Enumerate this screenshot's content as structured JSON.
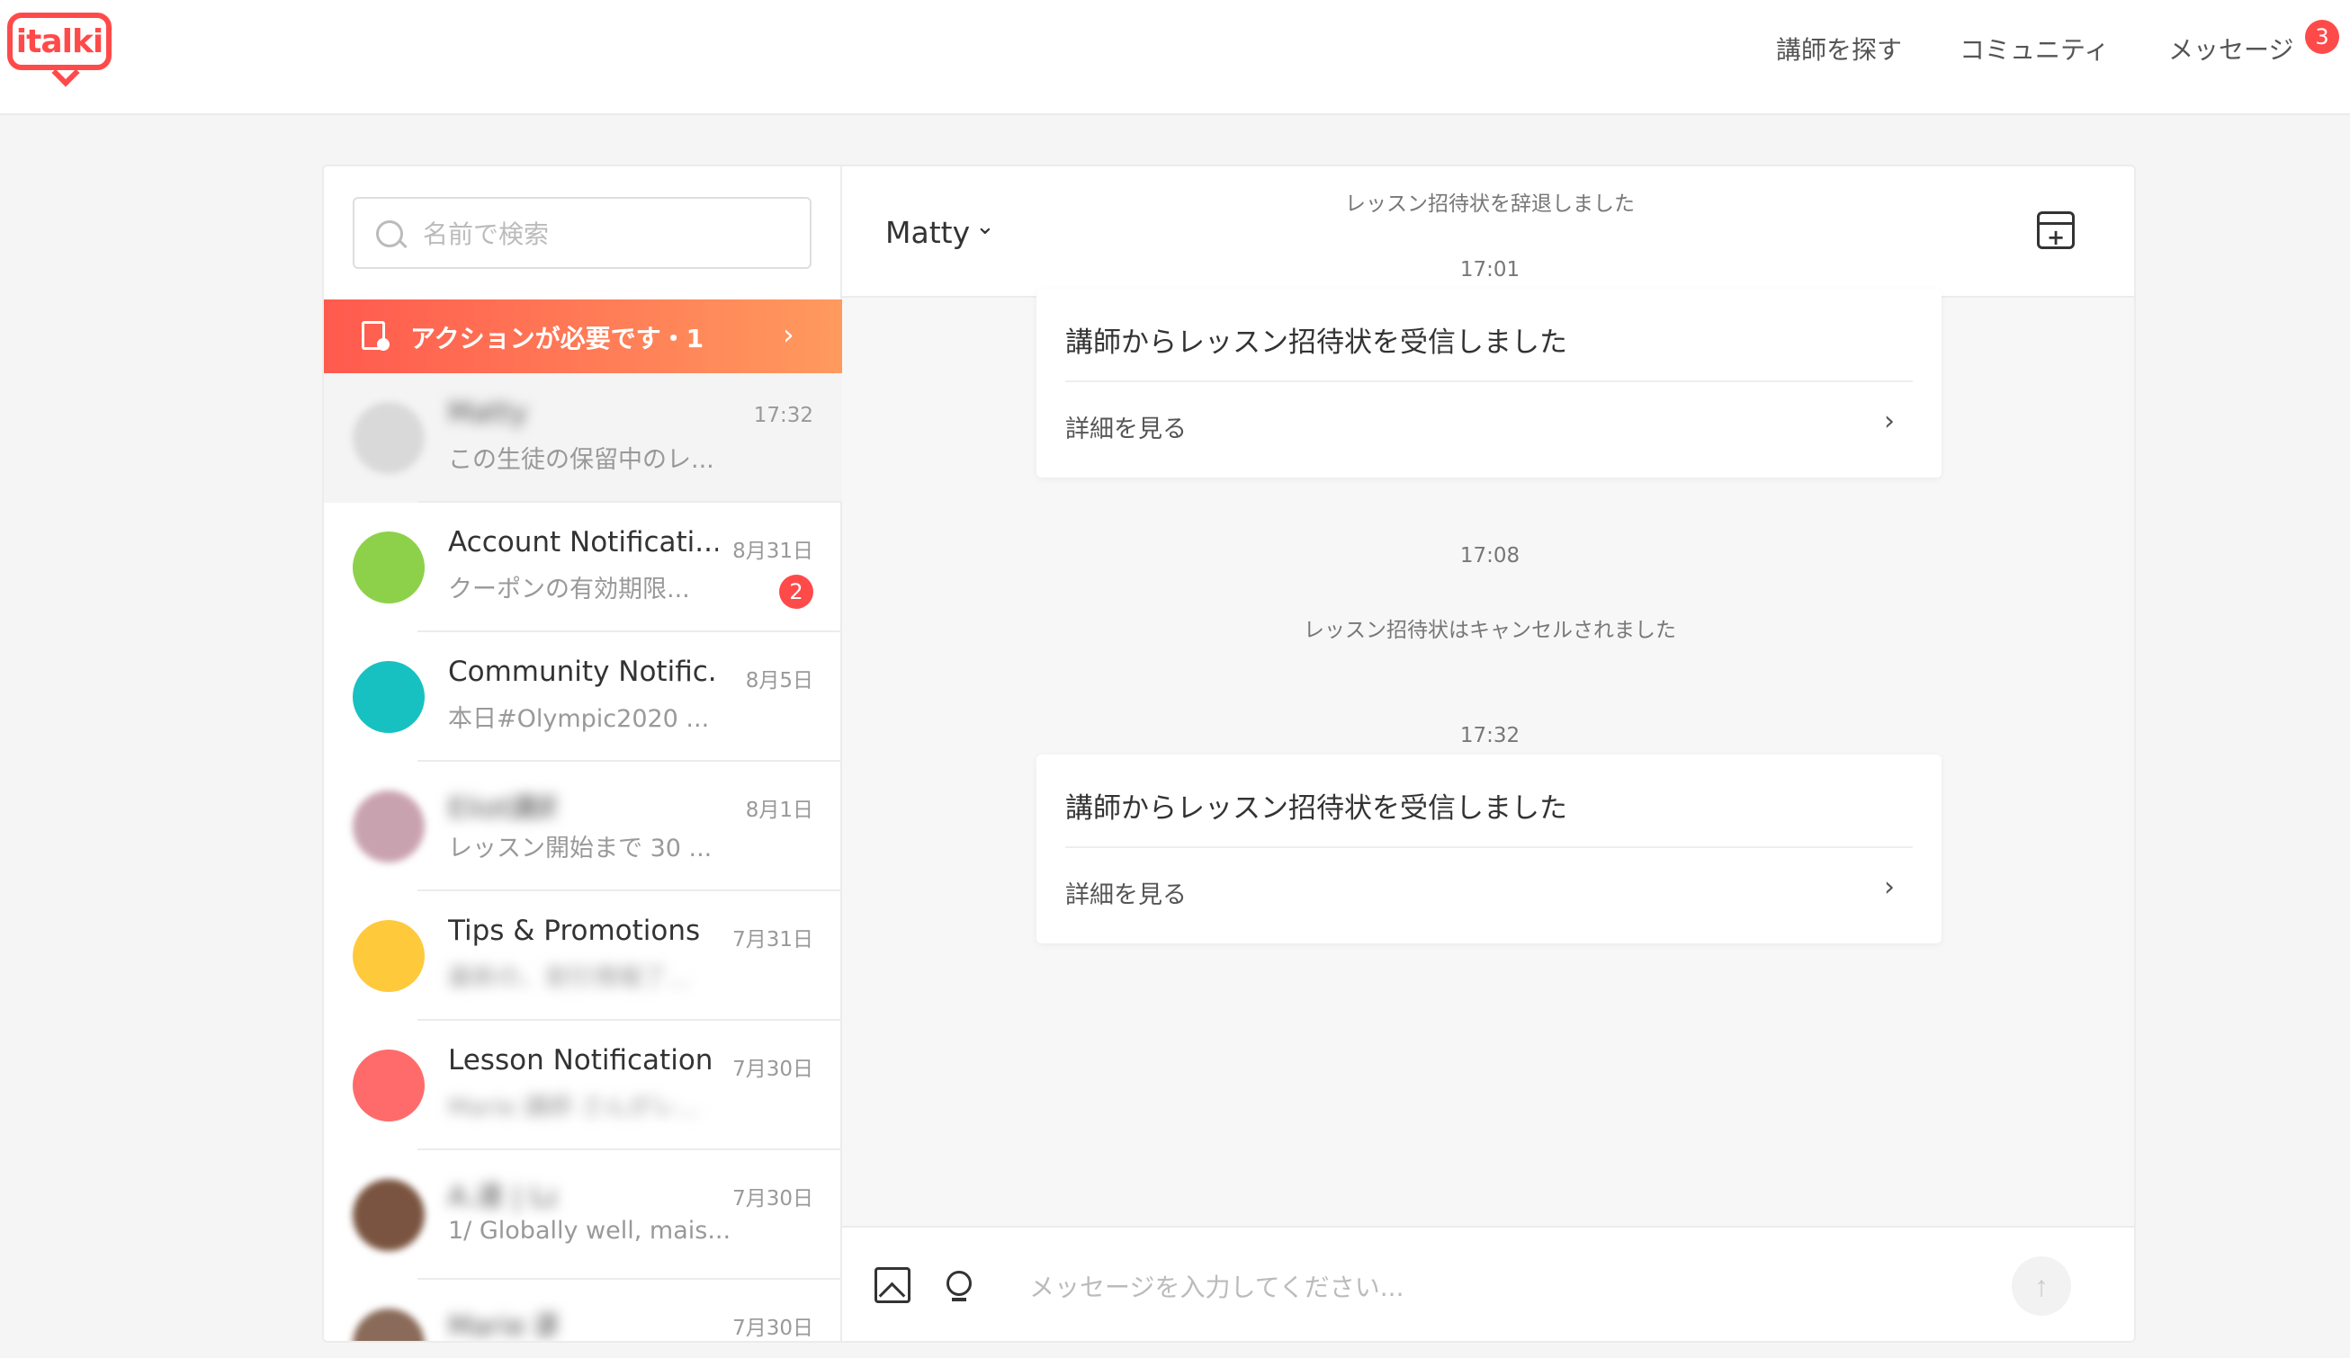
{
  "brand": {
    "logo_text": "italki",
    "accent": "#ff4a4a"
  },
  "nav": {
    "find_teacher": "講師を探す",
    "community": "コミュニティ",
    "messages": "メッセージ",
    "messages_badge": "3"
  },
  "sidebar": {
    "search_placeholder": "名前で検索",
    "action_banner": "アクションが必要です・1",
    "conversations": [
      {
        "name": "Matty",
        "preview": "この生徒の保留中のレ...",
        "time": "17:32",
        "avatar_color": "#d9d9d9",
        "blurred_name": true,
        "blurred_preview": false,
        "active": true
      },
      {
        "name": "Account Notificati...",
        "preview": "クーポンの有効期限...",
        "time": "8月31日",
        "avatar_color": "#8dd14a",
        "badge": "2",
        "blurred_name": false,
        "blurred_preview": false
      },
      {
        "name": "Community Notific...",
        "preview": "本日#Olympic2020 ...",
        "time": "8月5日",
        "avatar_color": "#17c1c1",
        "blurred_name": false,
        "blurred_preview": false
      },
      {
        "name": "Eliot講師",
        "preview": "レッスン開始まで 30 ...",
        "time": "8月1日",
        "avatar_color": "#c9a2b0",
        "blurred_name": true,
        "blurred_preview": false
      },
      {
        "name": "Tips & Promotions",
        "preview": "最新の、割引情報了...",
        "time": "7月31日",
        "avatar_color": "#ffc93c",
        "blurred_name": false,
        "blurred_preview": true
      },
      {
        "name": "Lesson Notification",
        "preview": "Marie 講師 さんがレ...",
        "time": "7月30日",
        "avatar_color": "#ff6b6b",
        "blurred_name": false,
        "blurred_preview": true
      },
      {
        "name": "A.達 | Language C...",
        "preview": "1/ Globally well, mais...",
        "time": "7月30日",
        "avatar_color": "#7a5440",
        "blurred_name": true,
        "blurred_preview": false
      },
      {
        "name": "Marie 講師",
        "preview": "",
        "time": "7月30日",
        "avatar_color": "#8a6a58",
        "blurred_name": true,
        "blurred_preview": false
      }
    ]
  },
  "chat": {
    "title": "Matty",
    "messages": {
      "declined": "レッスン招待状を辞退しました",
      "time1": "17:01",
      "card1_title": "講師からレッスン招待状を受信しました",
      "card1_link": "詳細を見る",
      "time2": "17:08",
      "cancelled": "レッスン招待状はキャンセルされました",
      "time3": "17:32",
      "card2_title": "講師からレッスン招待状を受信しました",
      "card2_link": "詳細を見る"
    },
    "composer_placeholder": "メッセージを入力してください..."
  }
}
